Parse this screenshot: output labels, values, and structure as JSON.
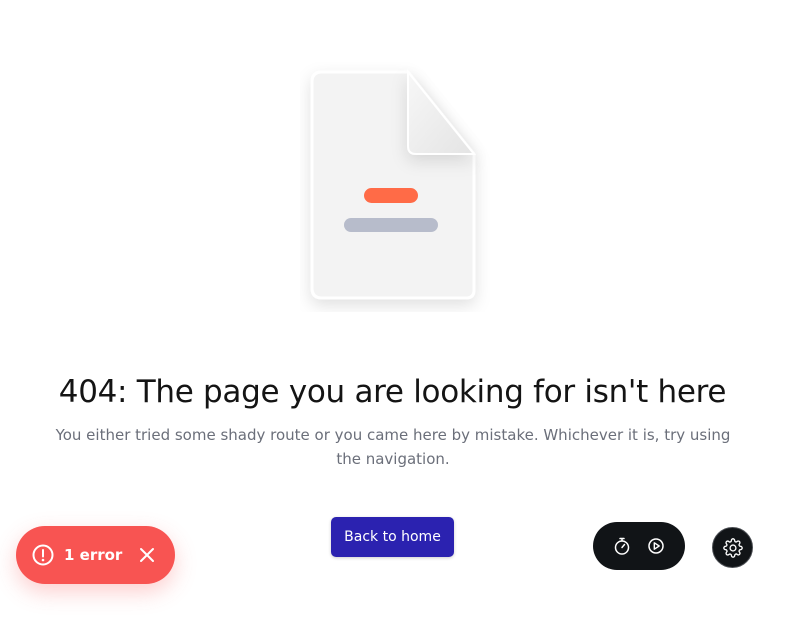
{
  "page": {
    "title": "404: The page you are looking for isn't here",
    "description": "You either tried some shady route or you came here by mistake. Whichever it is, try using the navigation.",
    "home_button_label": "Back to home"
  },
  "error_toast": {
    "label": "1 error",
    "icon": "alert-circle-icon",
    "close_icon": "close-icon"
  },
  "toolbar": {
    "icons": [
      "stopwatch-icon",
      "play-icon"
    ],
    "settings_icon": "gear-icon"
  },
  "colors": {
    "primary_button": "#2b22b0",
    "error_toast": "#f85452",
    "toolbar": "#111417",
    "illustration_accent": "#ff6b47",
    "illustration_bar": "#b7bccb"
  }
}
